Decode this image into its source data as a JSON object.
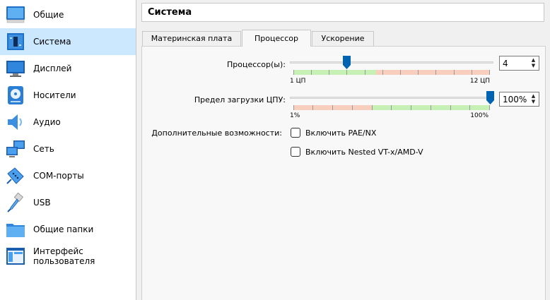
{
  "sidebar": {
    "items": [
      {
        "label": "Общие",
        "icon": "general-monitor-icon",
        "selected": false
      },
      {
        "label": "Система",
        "icon": "system-board-icon",
        "selected": true
      },
      {
        "label": "Дисплей",
        "icon": "display-monitor-icon",
        "selected": false
      },
      {
        "label": "Носители",
        "icon": "storage-disk-icon",
        "selected": false
      },
      {
        "label": "Аудио",
        "icon": "speaker-icon",
        "selected": false
      },
      {
        "label": "Сеть",
        "icon": "network-icon",
        "selected": false
      },
      {
        "label": "COM-порты",
        "icon": "serial-port-icon",
        "selected": false
      },
      {
        "label": "USB",
        "icon": "usb-icon",
        "selected": false
      },
      {
        "label": "Общие папки",
        "icon": "shared-folder-icon",
        "selected": false
      },
      {
        "label": "Интерфейс пользователя",
        "icon": "user-interface-icon",
        "selected": false
      }
    ]
  },
  "header": {
    "title": "Система"
  },
  "tabs": [
    {
      "label": "Материнская плата",
      "active": false
    },
    {
      "label": "Процессор",
      "active": true
    },
    {
      "label": "Ускорение",
      "active": false
    }
  ],
  "processor": {
    "label": "Процессор(ы):",
    "value": "4",
    "min": 1,
    "max": 12,
    "current": 4,
    "min_label": "1 ЦП",
    "max_label": "12 ЦП"
  },
  "exec_cap": {
    "label": "Предел загрузки ЦПУ:",
    "value": "100%",
    "min_label": "1%",
    "max_label": "100%",
    "current_percent": 100
  },
  "extended": {
    "label": "Дополнительные возможности:",
    "pae_label": "Включить PAE/NX",
    "pae_checked": false,
    "nested_label": "Включить Nested VT-x/AMD-V",
    "nested_checked": false
  },
  "colors": {
    "selection": "#cce8ff",
    "slider_thumb": "#0063b1",
    "scale_green": "#c6f0b4",
    "scale_red": "#f8cfbe"
  }
}
